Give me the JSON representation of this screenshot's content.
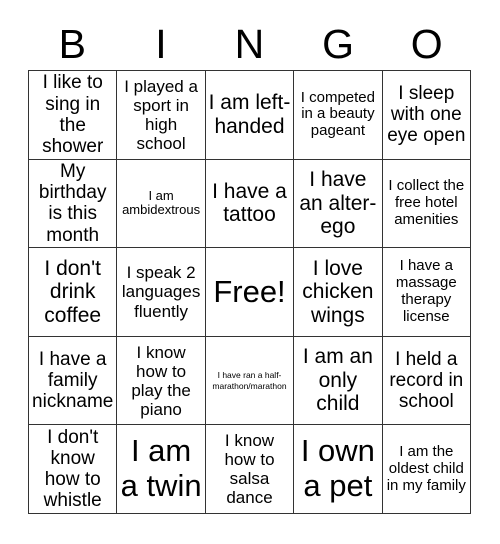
{
  "header": {
    "letters": [
      "B",
      "I",
      "N",
      "G",
      "O"
    ]
  },
  "grid": {
    "columns": 5,
    "rows": 5,
    "border_color": "#333333",
    "background_color": "#ffffff",
    "text_color": "#000000",
    "cells": [
      {
        "text": "I like to sing in the shower",
        "size": "l",
        "free": false
      },
      {
        "text": "I played a sport in high school",
        "size": "m",
        "free": false
      },
      {
        "text": "I am left-handed",
        "size": "xl",
        "free": false
      },
      {
        "text": "I competed in a beauty pageant",
        "size": "s",
        "free": false
      },
      {
        "text": "I sleep with one eye open",
        "size": "l",
        "free": false
      },
      {
        "text": "My birthday is this month",
        "size": "l",
        "free": false
      },
      {
        "text": "I am ambidextrous",
        "size": "xs",
        "free": false
      },
      {
        "text": "I have a tattoo",
        "size": "xl",
        "free": false
      },
      {
        "text": "I have an alter-ego",
        "size": "xl",
        "free": false
      },
      {
        "text": "I collect the free hotel amenities",
        "size": "s",
        "free": false
      },
      {
        "text": "I don't drink coffee",
        "size": "xl",
        "free": false
      },
      {
        "text": "I speak 2 languages fluently",
        "size": "m",
        "free": false
      },
      {
        "text": "Free!",
        "size": "xxl",
        "free": true
      },
      {
        "text": "I love chicken wings",
        "size": "xl",
        "free": false
      },
      {
        "text": "I have a massage therapy license",
        "size": "s",
        "free": false
      },
      {
        "text": "I have a family nickname",
        "size": "l",
        "free": false
      },
      {
        "text": "I know how to play the piano",
        "size": "m",
        "free": false
      },
      {
        "text": "I have ran a half-marathon/marathon",
        "size": "xxs",
        "free": false
      },
      {
        "text": "I am an only child",
        "size": "xl",
        "free": false
      },
      {
        "text": "I held a record in school",
        "size": "l",
        "free": false
      },
      {
        "text": "I don't know how to whistle",
        "size": "l",
        "free": false
      },
      {
        "text": "I am a twin",
        "size": "xxl",
        "free": false
      },
      {
        "text": "I know how to salsa dance",
        "size": "m",
        "free": false
      },
      {
        "text": "I own a pet",
        "size": "xxl",
        "free": false
      },
      {
        "text": "I am the oldest child in my family",
        "size": "s",
        "free": false
      }
    ]
  }
}
